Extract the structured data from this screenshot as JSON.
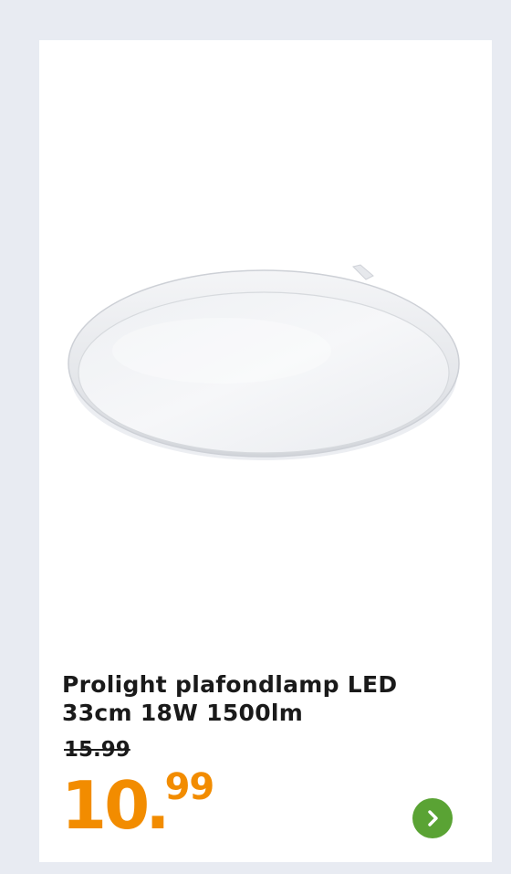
{
  "product": {
    "image_alt": "Prolight plafondlamp LED",
    "title_line1": "Prolight plafondlamp LED",
    "title_line2": "33cm 18W 1500lm",
    "old_price": "15.99",
    "price_integer": "10",
    "price_separator": ".",
    "price_decimal": "99"
  },
  "colors": {
    "background": "#e8ebf2",
    "card": "#ffffff",
    "price": "#f28c00",
    "next_button": "#5aa334"
  },
  "icons": {
    "next": "chevron-right-icon"
  }
}
